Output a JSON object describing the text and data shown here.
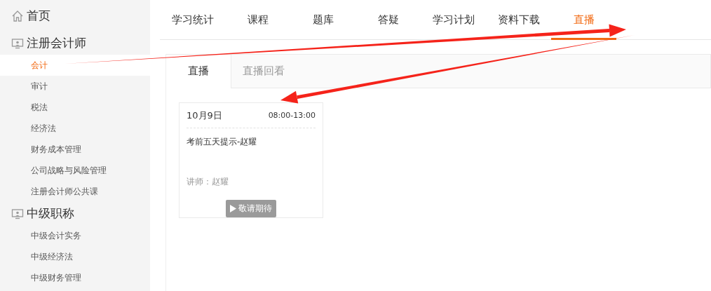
{
  "sidebar": {
    "groups": [
      {
        "label": "首页",
        "kind": "home"
      },
      {
        "label": "注册会计师",
        "kind": "section",
        "items": [
          {
            "label": "会计",
            "selected": true
          },
          {
            "label": "审计",
            "selected": false
          },
          {
            "label": "税法",
            "selected": false
          },
          {
            "label": "经济法",
            "selected": false
          },
          {
            "label": "财务成本管理",
            "selected": false
          },
          {
            "label": "公司战略与风险管理",
            "selected": false
          },
          {
            "label": "注册会计师公共课",
            "selected": false
          }
        ]
      },
      {
        "label": "中级职称",
        "kind": "section",
        "items": [
          {
            "label": "中级会计实务",
            "selected": false
          },
          {
            "label": "中级经济法",
            "selected": false
          },
          {
            "label": "中级财务管理",
            "selected": false
          }
        ]
      }
    ]
  },
  "tabs": [
    {
      "label": "学习统计",
      "selected": false
    },
    {
      "label": "课程",
      "selected": false
    },
    {
      "label": "题库",
      "selected": false
    },
    {
      "label": "答疑",
      "selected": false
    },
    {
      "label": "学习计划",
      "selected": false
    },
    {
      "label": "资料下载",
      "selected": false
    },
    {
      "label": "直播",
      "selected": true
    }
  ],
  "subtabs": [
    {
      "label": "直播",
      "selected": true
    },
    {
      "label": "直播回看",
      "selected": false
    }
  ],
  "cards": [
    {
      "date": "10月9日",
      "time": "08:00-13:00",
      "title": "考前五天提示-赵耀",
      "teacher": "讲师：赵耀",
      "button": {
        "label": "敬请期待",
        "disabled": true
      }
    }
  ],
  "annotations": [
    {
      "kind": "arrow"
    },
    {
      "kind": "arrow"
    }
  ]
}
